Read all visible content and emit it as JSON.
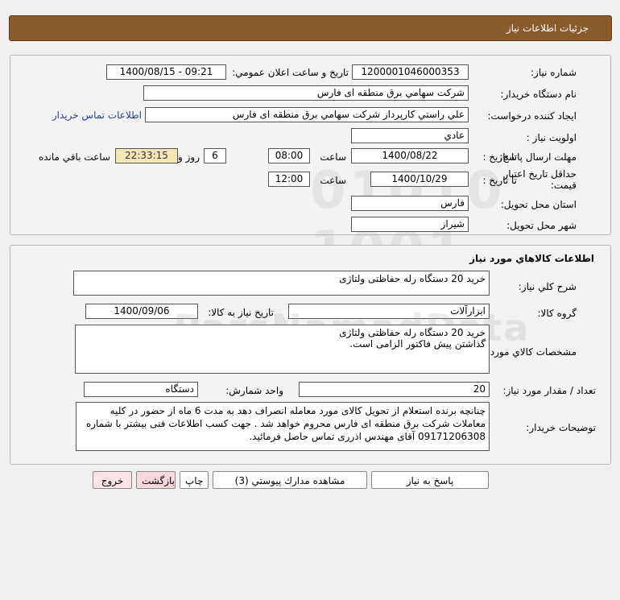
{
  "header": {
    "title": "جزئيات اطلاعات نياز"
  },
  "info": {
    "need_number_label": "شماره نياز:",
    "need_number": "1200001046000353",
    "announce_label": "تاريخ و ساعت اعلان عمومي:",
    "announce_value": "1400/08/15 - 09:21",
    "buyer_label": "نام دستگاه خريدار:",
    "buyer_value": "شركت سهامي برق منطقه اى فارس",
    "creator_label": "ايجاد كننده درخواست:",
    "creator_value": "علي راستي كارپرداز شركت سهامي برق منطقه اى فارس",
    "contact_link": "اطلاعات تماس خريدار",
    "priority_label": "اولويت نياز :",
    "priority_value": "عادي",
    "deadline_label": "مهلت ارسال پاسخ:",
    "until_date_label": "تا تاريخ :",
    "deadline_date": "1400/08/22",
    "hour_label": "ساعت",
    "deadline_time": "08:00",
    "days_value": "6",
    "days_label": "روز و",
    "remaining_time": "22:33:15",
    "remaining_label": "ساعت باقي مانده",
    "validity_label": "حداقل تاريخ اعتبار قيمت:",
    "validity_until_label": "تا تاريخ :",
    "validity_date": "1400/10/29",
    "validity_hour_label": "ساعت",
    "validity_time": "12:00",
    "province_label": "استان محل تحويل:",
    "province_value": "فارس",
    "city_label": "شهر محل تحويل:",
    "city_value": "شيراز"
  },
  "goods": {
    "section_title": "اطلاعات كالاهاي مورد نياز",
    "summary_label": "شرح كلي نياز:",
    "summary_value": "خريد 20 دستگاه رله حفاظتی ولتاژی",
    "group_label": "گروه كالا:",
    "group_value": "ابزارآلات",
    "need_date_label": "تاريخ نياز به كالا:",
    "need_date_value": "1400/09/06",
    "specs_label": "مشخصات كالاي مورد نياز:",
    "specs_line1": "خرید 20 دستگاه رله حفاظتی ولتاژی",
    "specs_line2": "گذاشتن پیش فاکتور الزامی است.",
    "qty_label": "تعداد / مقدار مورد نياز:",
    "qty_value": "20",
    "unit_label": "واحد شمارش:",
    "unit_value": "دستگاه",
    "notes_label": "توضيحات خريدار:",
    "notes_value": "چنانچه برنده استعلام از تحویل کالای مورد معامله انصراف دهد به مدت 6 ماه از حضور در کلیه معاملات شرکت برق منطقه ای فارس محروم خواهد شد . جهت کسب اطلاعات فنی بیشتر با شماره 09171206308 آقای مهندس اذرری تماس حاصل فرمائید."
  },
  "buttons": {
    "reply": "پاسخ به نياز",
    "docs": "مشاهده مدارك پيوستي (3)",
    "print": "چاپ",
    "back": "بازگشت",
    "exit": "خروج"
  }
}
